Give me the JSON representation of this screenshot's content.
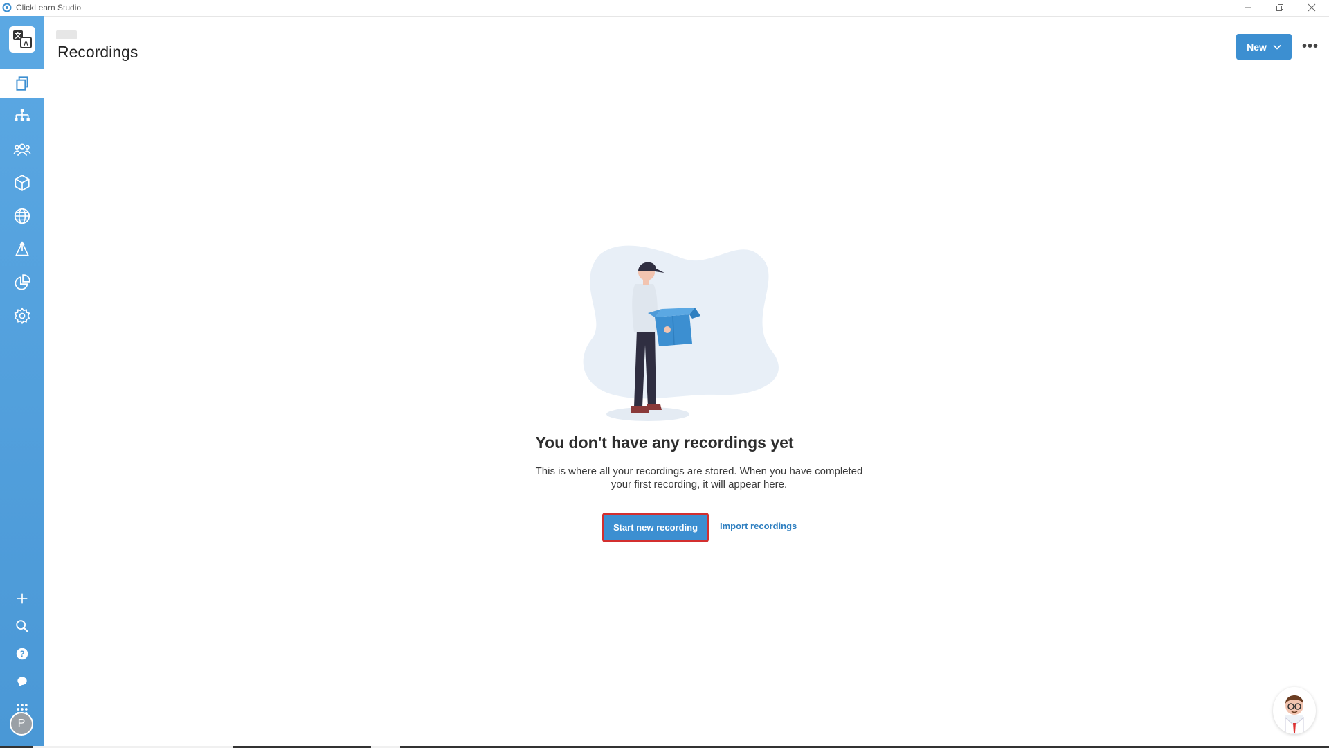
{
  "window": {
    "title": "ClickLearn Studio",
    "minimize_icon": "minimize-icon",
    "restore_icon": "restore-icon",
    "close_icon": "close-icon"
  },
  "sidebar": {
    "colors": {
      "top": "#5ba8e3",
      "bottom": "#4a98d6"
    },
    "top_items": [
      {
        "name": "recordings",
        "icon": "copy-icon",
        "active": true
      },
      {
        "name": "structure",
        "icon": "sitemap-icon"
      },
      {
        "name": "users",
        "icon": "users-icon"
      },
      {
        "name": "packages",
        "icon": "box-icon"
      },
      {
        "name": "languages",
        "icon": "globe-icon"
      },
      {
        "name": "publish",
        "icon": "publish-icon"
      },
      {
        "name": "analytics",
        "icon": "pie-chart-icon"
      },
      {
        "name": "settings",
        "icon": "gear-icon"
      }
    ],
    "bottom_items": [
      {
        "name": "add",
        "icon": "plus-icon"
      },
      {
        "name": "search",
        "icon": "search-icon"
      },
      {
        "name": "help",
        "icon": "help-icon"
      },
      {
        "name": "chat",
        "icon": "chat-icon"
      },
      {
        "name": "apps",
        "icon": "grid-icon"
      }
    ],
    "avatar_initial": "P"
  },
  "header": {
    "title": "Recordings",
    "new_button": "New",
    "more_button": "•••"
  },
  "empty_state": {
    "title": "You don't have any recordings yet",
    "description_line1": "This is where all your recordings are stored. When you have completed",
    "description_line2": "your first recording, it will appear here.",
    "primary_action": "Start new recording",
    "secondary_action": "Import recordings"
  },
  "colors": {
    "accent": "#3c8fd1",
    "highlight_border": "#d32f2f",
    "link": "#2f7fc0"
  }
}
